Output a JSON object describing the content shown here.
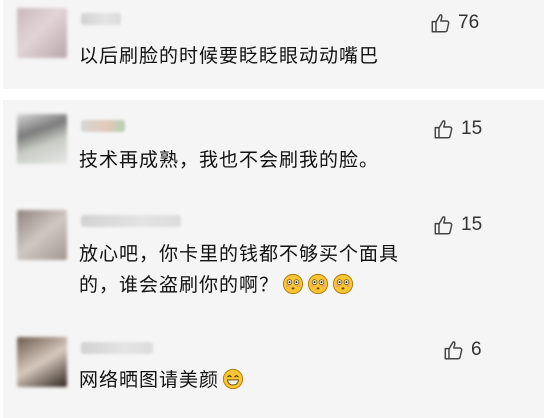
{
  "comments": [
    {
      "text": "以后刷脸的时候要眨眨眼动动嘴巴",
      "likes": "76",
      "emojis": []
    },
    {
      "text": "技术再成熟，我也不会刷我的脸。",
      "likes": "15",
      "emojis": []
    },
    {
      "text_line1": "放心吧，你卡里的钱都不够买个面具",
      "text_line2": "的，谁会盗刷你的啊？",
      "likes": "15",
      "emojis": [
        "flushed-face",
        "flushed-face",
        "flushed-face"
      ]
    },
    {
      "text": "网络晒图请美颜",
      "likes": "6",
      "emojis": [
        "grinning-face"
      ]
    }
  ],
  "colors": {
    "card_background": "#f5f5f5",
    "page_background": "#ffffff",
    "text": "#111111",
    "like_icon": "#333333",
    "emoji_yellow": "#f7c531"
  },
  "icons": {
    "like": "thumbs-up-icon"
  }
}
